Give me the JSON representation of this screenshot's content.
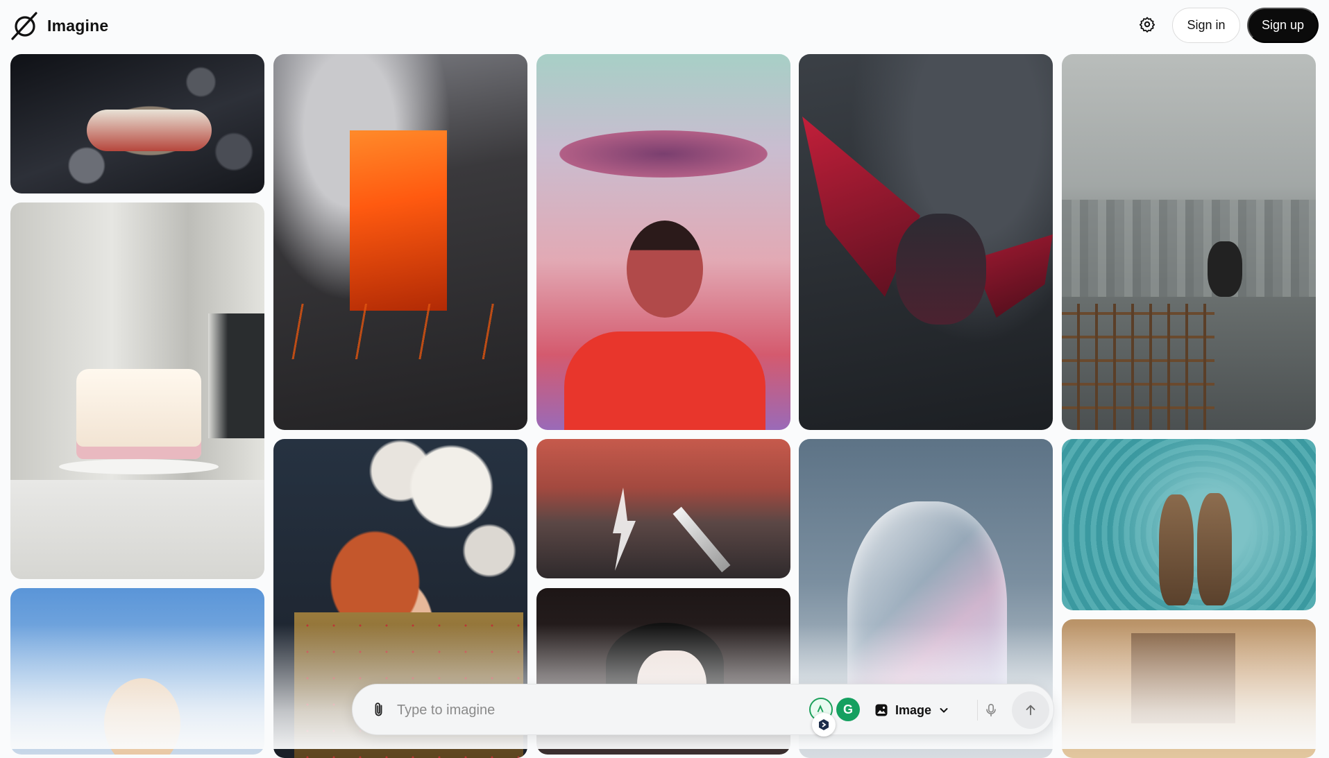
{
  "app": {
    "name": "Imagine"
  },
  "header": {
    "settings_icon": "gear-icon",
    "sign_in_label": "Sign in",
    "sign_up_label": "Sign up"
  },
  "gallery": {
    "items": [
      {
        "subject": "steamship-in-asteroid-field",
        "colors": [
          "#1b1d24",
          "#5b5e68"
        ]
      },
      {
        "subject": "birthday-cake-with-doll-figures",
        "colors": [
          "#d8d8d4",
          "#f2f1ee"
        ]
      },
      {
        "subject": "laughing-woman-blue-sky",
        "colors": [
          "#6ea6df",
          "#c7d9ec"
        ]
      },
      {
        "subject": "erupting-volcano-lava",
        "colors": [
          "#2b2a2c",
          "#ff6a1e"
        ]
      },
      {
        "subject": "redhead-with-pearls-and-armor",
        "colors": [
          "#1e2530",
          "#c25a2a"
        ]
      },
      {
        "subject": "ufo-above-boy-red-sweater",
        "colors": [
          "#b6cfcf",
          "#e3473b"
        ]
      },
      {
        "subject": "sword-and-lightning-battlefield",
        "colors": [
          "#c55a4b",
          "#3a3436"
        ]
      },
      {
        "subject": "dark-haired-girl-portrait",
        "colors": [
          "#1d1616",
          "#ece3df"
        ]
      },
      {
        "subject": "dragon-rider-storm",
        "colors": [
          "#2f3338",
          "#9c2235"
        ]
      },
      {
        "subject": "glass-hand-sky",
        "colors": [
          "#5f7486",
          "#d8dde2"
        ]
      },
      {
        "subject": "man-jumping-rooftop-city",
        "colors": [
          "#8d9494",
          "#3e4344"
        ]
      },
      {
        "subject": "two-otters-in-water",
        "colors": [
          "#2c8b93",
          "#9ccfd2"
        ]
      },
      {
        "subject": "ornate-warm-interior",
        "colors": [
          "#b08a5e",
          "#ead7bb"
        ]
      }
    ]
  },
  "prompt": {
    "placeholder": "Type to imagine",
    "value": "",
    "attach_icon": "paperclip-icon",
    "mode_label": "Image",
    "mode_icon": "image-icon",
    "mic_icon": "microphone-icon",
    "send_icon": "arrow-up-icon"
  }
}
